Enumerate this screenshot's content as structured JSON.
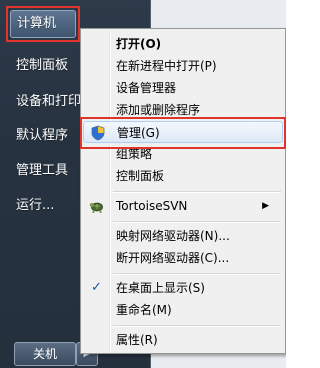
{
  "start_menu": {
    "items": [
      {
        "label": "计算机",
        "selected": true
      },
      {
        "label": "控制面板"
      },
      {
        "label": "设备和打印机"
      },
      {
        "label": "默认程序"
      },
      {
        "label": "管理工具"
      },
      {
        "label": "运行..."
      }
    ],
    "shutdown_label": "关机",
    "shutdown_arrow": "▶"
  },
  "context_menu": {
    "items": [
      {
        "label": "打开(O)",
        "bold": true
      },
      {
        "label": "在新进程中打开(P)"
      },
      {
        "label": "设备管理器"
      },
      {
        "label": "添加或删除程序"
      },
      {
        "label": "管理(G)",
        "icon": "shield-icon",
        "highlighted": true
      },
      {
        "label": "组策略"
      },
      {
        "label": "控制面板"
      },
      {
        "label": "TortoiseSVN",
        "icon": "tortoise-icon",
        "submenu": true
      },
      {
        "label": "映射网络驱动器(N)..."
      },
      {
        "label": "断开网络驱动器(C)..."
      },
      {
        "label": "在桌面上显示(S)",
        "checked": true
      },
      {
        "label": "重命名(M)"
      },
      {
        "label": "属性(R)"
      }
    ],
    "submenu_arrow": "▶",
    "check_mark": "✓"
  },
  "colors": {
    "highlight_frame": "#e0342d",
    "menu_background": "#f0f0f0",
    "start_pane": "#263240"
  }
}
